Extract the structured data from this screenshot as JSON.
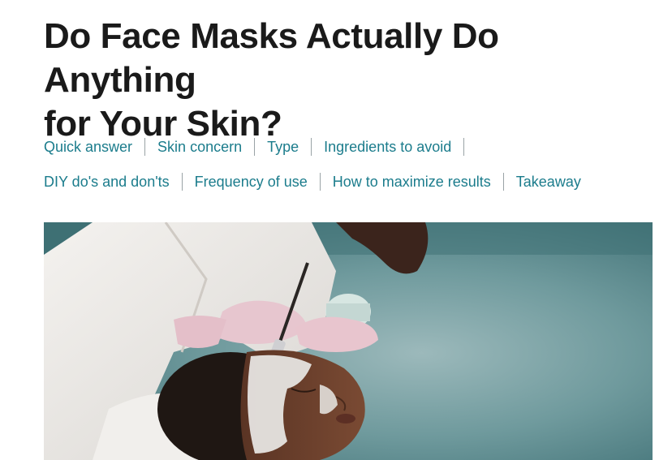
{
  "article": {
    "title_line1": "Do Face Masks Actually Do Anything",
    "title_line2": "for Your Skin?"
  },
  "toc": {
    "row1": [
      {
        "label": "Quick answer"
      },
      {
        "label": "Skin concern"
      },
      {
        "label": "Type"
      },
      {
        "label": "Ingredients to avoid"
      }
    ],
    "row2": [
      {
        "label": "DIY do's and don'ts"
      },
      {
        "label": "Frequency of use"
      },
      {
        "label": "How to maximize results"
      },
      {
        "label": "Takeaway"
      }
    ]
  },
  "hero_image": {
    "subject": "person-receiving-face-mask-treatment"
  },
  "colors": {
    "link": "#1b7c8c",
    "title": "#1a1a1a",
    "separator": "#9aa3a6"
  }
}
